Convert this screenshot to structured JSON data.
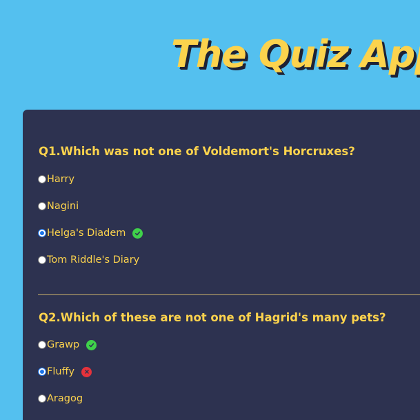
{
  "app": {
    "title": "The Quiz App"
  },
  "questions": [
    {
      "text": "Q1.Which was not one of Voldemort's Horcruxes?",
      "options": [
        {
          "label": "Harry",
          "selected": false,
          "status": "none"
        },
        {
          "label": "Nagini",
          "selected": false,
          "status": "none"
        },
        {
          "label": "Helga's Diadem",
          "selected": true,
          "status": "correct"
        },
        {
          "label": "Tom Riddle's Diary",
          "selected": false,
          "status": "none"
        }
      ]
    },
    {
      "text": "Q2.Which of these are not one of Hagrid's many pets?",
      "options": [
        {
          "label": "Grawp",
          "selected": false,
          "status": "correct"
        },
        {
          "label": "Fluffy",
          "selected": true,
          "status": "wrong"
        },
        {
          "label": "Aragog",
          "selected": false,
          "status": "none"
        }
      ]
    }
  ],
  "colors": {
    "page_background": "#54c0ef",
    "card_background": "#2d3250",
    "accent_text": "#fcd34d",
    "correct": "#3fd14a",
    "wrong": "#e5323b",
    "radio_selected": "#1a73e8"
  },
  "icons": {
    "correct": "check-circle-icon",
    "wrong": "x-circle-icon"
  }
}
